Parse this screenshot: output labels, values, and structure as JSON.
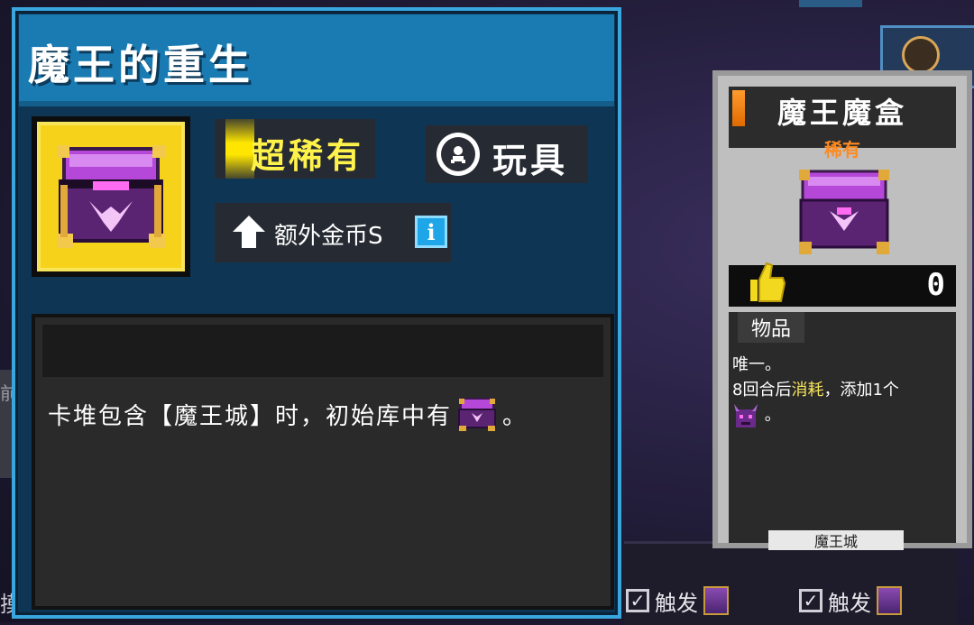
{
  "main": {
    "title": "魔王的重生",
    "rarity": "超稀有",
    "type_label": "玩具",
    "bonus_label": "额外金币S",
    "info_glyph": "i",
    "description": {
      "prefix": "卡堆包含【魔王城】时，初始库中有",
      "suffix": "。"
    }
  },
  "tooltip": {
    "name": "魔王魔盒",
    "rarity": "稀有",
    "likes": "0",
    "tag": "物品",
    "line1": "唯一。",
    "line2_prefix": "8回合后",
    "line2_highlight": "消耗",
    "line2_suffix": "，添加1个",
    "line3_suffix": "。",
    "footer": "魔王城"
  },
  "background": {
    "trigger_label": "触发",
    "left_glyph": "前",
    "bottom_left_glyph": "摸"
  },
  "colors": {
    "panel_border": "#3aa6de",
    "rarity_yellow": "#fff24a",
    "tooltip_rarity_orange": "#ff8a1f",
    "highlight": "#f7e55a"
  }
}
